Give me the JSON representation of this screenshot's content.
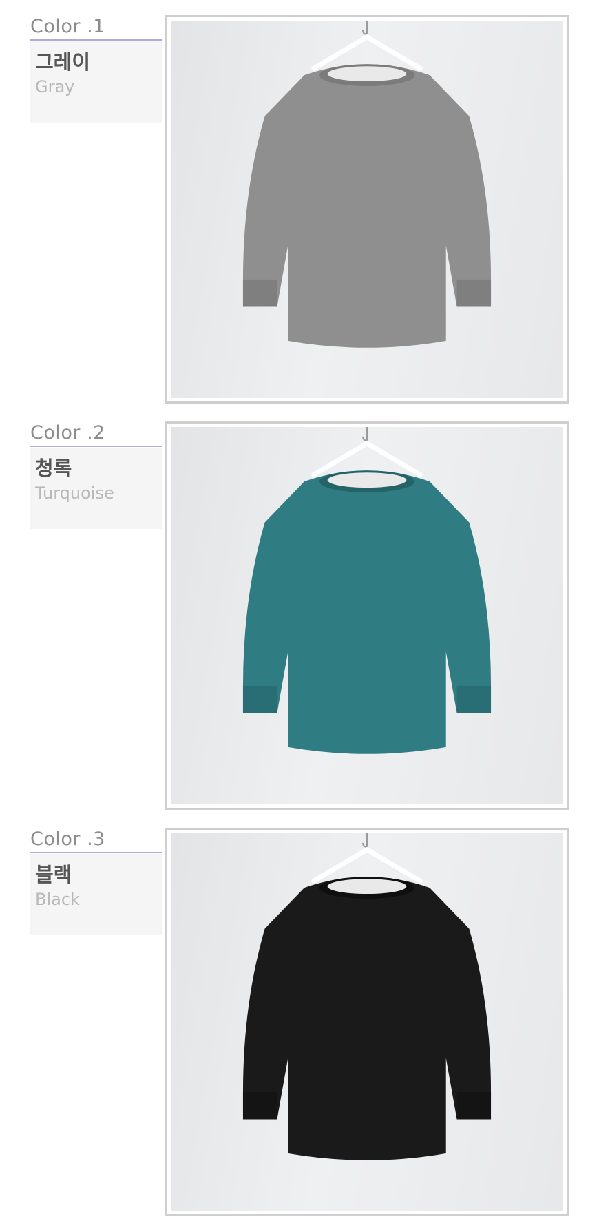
{
  "colors": [
    {
      "heading": "Color .1",
      "name_ko": "그레이",
      "name_en": "Gray",
      "swatch": "#8f8f8f",
      "cuff": "#7f7f7f",
      "collar": "#7b7b7b"
    },
    {
      "heading": "Color .2",
      "name_ko": "청록",
      "name_en": "Turquoise",
      "swatch": "#2f7d83",
      "cuff": "#286e74",
      "collar": "#246469"
    },
    {
      "heading": "Color .3",
      "name_ko": "블랙",
      "name_en": "Black",
      "swatch": "#1a1a1a",
      "cuff": "#141414",
      "collar": "#0f0f0f"
    }
  ],
  "accent_rule_color": "#b5a9db",
  "frame_border_color": "#cfcfcf"
}
